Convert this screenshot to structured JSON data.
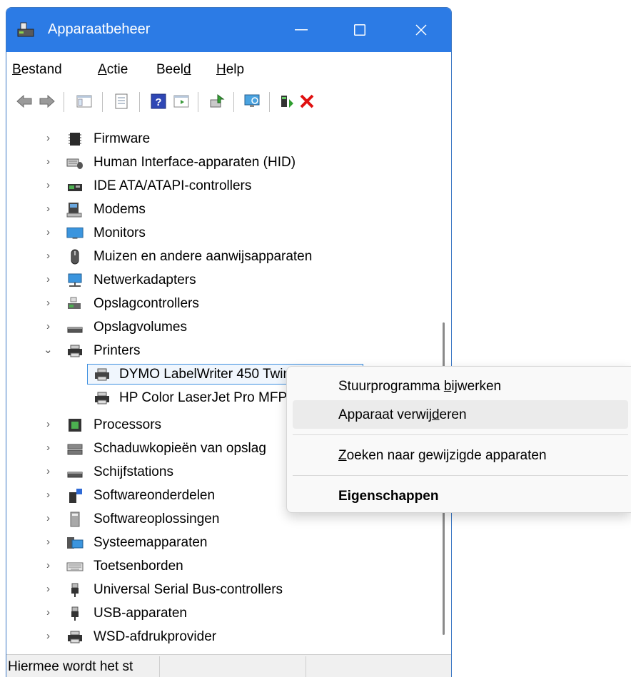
{
  "window": {
    "title": "Apparaatbeheer"
  },
  "titlebar": {
    "minimize": "—",
    "maximize": "☐",
    "close": "✕"
  },
  "menu": [
    {
      "pre": "",
      "accel": "B",
      "post": "estand"
    },
    {
      "pre": "",
      "accel": "A",
      "post": "ctie"
    },
    {
      "pre": "Beel",
      "accel": "d",
      "post": ""
    },
    {
      "pre": "",
      "accel": "H",
      "post": "elp"
    }
  ],
  "toolbar": {
    "icons": [
      "back-arrow-icon",
      "forward-arrow-icon",
      "show-hide-console-tree-icon",
      "properties-icon",
      "help-icon",
      "show-action-pane-icon",
      "update-driver-icon",
      "scan-hardware-icon",
      "add-legacy-hardware-icon",
      "enable-device-icon",
      "uninstall-device-icon"
    ]
  },
  "tree": [
    {
      "label": "Firmware",
      "expanded": false,
      "icon": "firmware-icon"
    },
    {
      "label": "Human Interface-apparaten (HID)",
      "expanded": false,
      "icon": "hid-icon"
    },
    {
      "label": "IDE ATA/ATAPI-controllers",
      "expanded": false,
      "icon": "ide-controller-icon"
    },
    {
      "label": "Modems",
      "expanded": false,
      "icon": "modem-icon"
    },
    {
      "label": "Monitors",
      "expanded": false,
      "icon": "monitor-icon"
    },
    {
      "label": "Muizen en andere aanwijsapparaten",
      "expanded": false,
      "icon": "mouse-icon"
    },
    {
      "label": "Netwerkadapters",
      "expanded": false,
      "icon": "network-adapter-icon"
    },
    {
      "label": "Opslagcontrollers",
      "expanded": false,
      "icon": "storage-controller-icon"
    },
    {
      "label": "Opslagvolumes",
      "expanded": false,
      "icon": "storage-volume-icon"
    },
    {
      "label": "Printers",
      "expanded": true,
      "icon": "printer-icon"
    },
    {
      "label": "DYMO LabelWriter 450 Twin Turbo",
      "child": true,
      "selected": true,
      "icon": "printer-icon"
    },
    {
      "label": "HP Color LaserJet Pro MFP M479fdw",
      "child": true,
      "icon": "printer-icon"
    },
    {
      "label": "Processors",
      "expanded": false,
      "icon": "processor-icon"
    },
    {
      "label": "Schaduwkopieën van opslag",
      "expanded": false,
      "icon": "shadow-copy-icon"
    },
    {
      "label": "Schijfstations",
      "expanded": false,
      "icon": "disk-drive-icon"
    },
    {
      "label": "Softwareonderdelen",
      "expanded": false,
      "icon": "software-component-icon"
    },
    {
      "label": "Softwareoplossingen",
      "expanded": false,
      "icon": "software-solution-icon"
    },
    {
      "label": "Systeemapparaten",
      "expanded": false,
      "icon": "system-device-icon"
    },
    {
      "label": "Toetsenborden",
      "expanded": false,
      "icon": "keyboard-icon"
    },
    {
      "label": "Universal Serial Bus-controllers",
      "expanded": false,
      "icon": "usb-icon"
    },
    {
      "label": "USB-apparaten",
      "expanded": false,
      "icon": "usb-icon"
    },
    {
      "label": "WSD-afdrukprovider",
      "expanded": false,
      "icon": "printer-icon"
    }
  ],
  "status": {
    "text": "Hiermee wordt het st"
  },
  "context_menu": [
    {
      "pre": "Stuurprogramma ",
      "accel": "b",
      "post": "ijwerken"
    },
    {
      "pre": "Apparaat verwij",
      "accel": "d",
      "post": "eren",
      "hover": true
    },
    {
      "pre": "",
      "accel": "Z",
      "post": "oeken naar gewijzigde apparaten"
    },
    {
      "pre": "",
      "accel": "",
      "post": "Eigenschappen",
      "bold": true
    }
  ]
}
